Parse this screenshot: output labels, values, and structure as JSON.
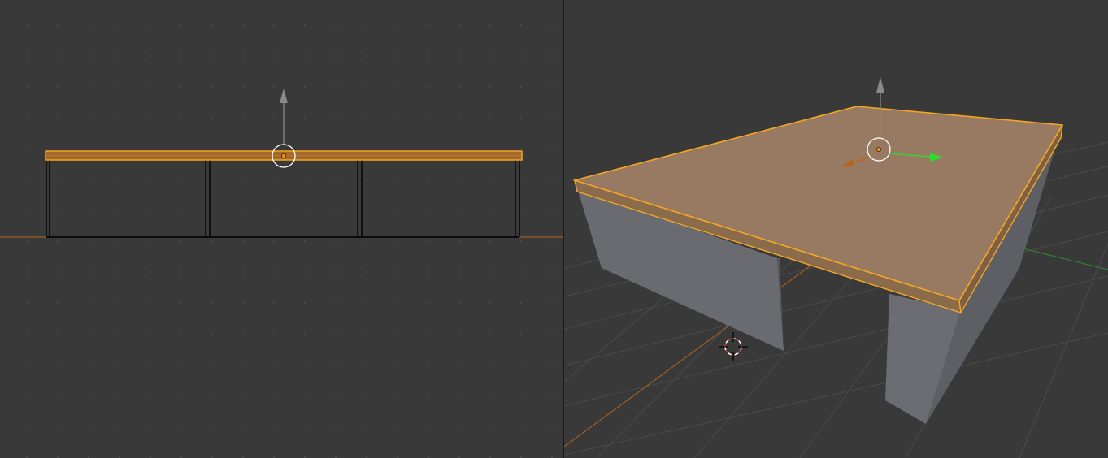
{
  "colors": {
    "background": "#393939",
    "selection": "#f5a623",
    "selected_face": "#977a61",
    "unselected_face": "#6a6b71",
    "x_axis": "#b5651d",
    "y_axis": "#2bdc2b",
    "z_axis": "#8a8a8a"
  },
  "views": [
    {
      "name": "front-orthographic",
      "gizmo": "translate-manipulator"
    },
    {
      "name": "user-perspective",
      "gizmo": "translate-manipulator"
    }
  ],
  "scene": {
    "selected_object": "table-top",
    "objects": [
      "table-top",
      "table-leg-left",
      "table-leg-right"
    ],
    "cursor": "3d-cursor"
  }
}
